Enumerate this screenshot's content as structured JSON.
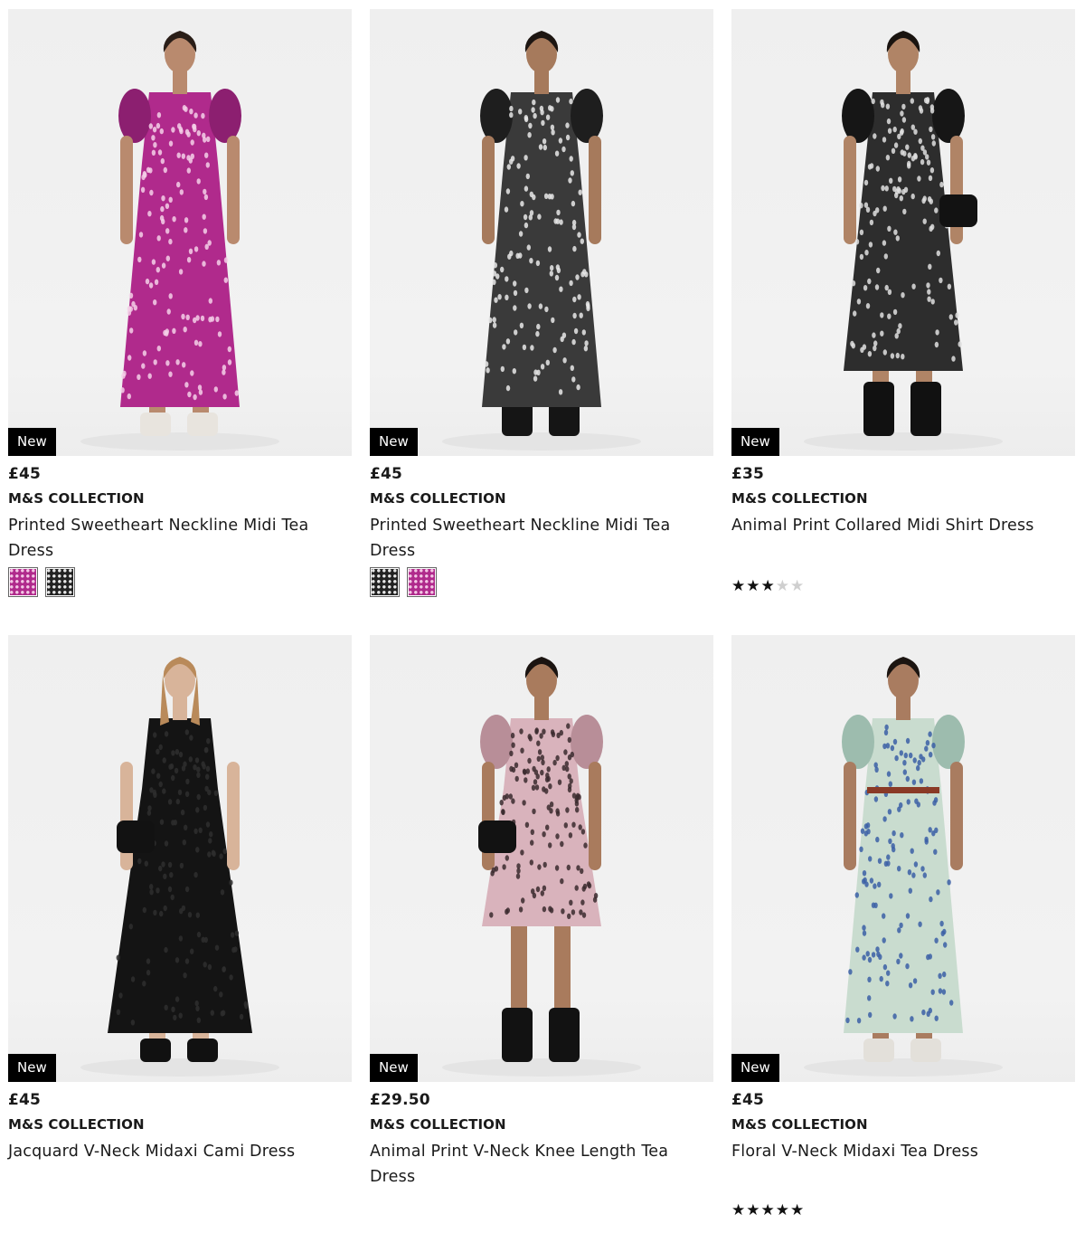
{
  "products": [
    {
      "badge": "New",
      "price": "£45",
      "brand": "M&S COLLECTION",
      "title": "Printed Sweetheart Neckline Midi Tea Dress",
      "image": "model-magenta-spot-dress",
      "colors": {
        "dress": "#b02a8c",
        "dress_dark": "#8c1f70",
        "pattern": "#f5d0e8",
        "shoes": "#e8e4de",
        "skin": "#b98a6e",
        "hair": "#2a1e18"
      },
      "swatches": [
        {
          "name": "magenta-print",
          "base": "#b02a8c",
          "dot": "#f3c6e4"
        },
        {
          "name": "black-white-print",
          "base": "#222222",
          "dot": "#e6e6e6"
        }
      ]
    },
    {
      "badge": "New",
      "price": "£45",
      "brand": "M&S COLLECTION",
      "title": "Printed Sweetheart Neckline Midi Tea Dress",
      "image": "model-monochrome-floral-dress",
      "colors": {
        "dress": "#3a3a3a",
        "dress_dark": "#1e1e1e",
        "pattern": "#e9e9e9",
        "shoes": "#151515",
        "skin": "#a67a5c",
        "hair": "#1d1612"
      },
      "swatches": [
        {
          "name": "black-white-print",
          "base": "#222222",
          "dot": "#e6e6e6"
        },
        {
          "name": "magenta-print",
          "base": "#b02a8c",
          "dot": "#f3c6e4"
        }
      ]
    },
    {
      "price": "£35",
      "badge": "New",
      "brand": "M&S COLLECTION",
      "title": "Animal Print Collared Midi Shirt Dress",
      "image": "model-animal-print-shirt-dress",
      "colors": {
        "dress": "#2d2d2d",
        "dress_dark": "#161616",
        "pattern": "#e0e0e0",
        "shoes": "#111111",
        "skin": "#b08466",
        "hair": "#1a1410"
      },
      "rating": 3
    },
    {
      "badge": "New",
      "price": "£45",
      "brand": "M&S COLLECTION",
      "title": "Jacquard V-Neck Midaxi Cami Dress",
      "image": "model-black-cami-dress",
      "colors": {
        "dress": "#141414",
        "dress_dark": "#050505",
        "pattern": "#2e2e2e",
        "shoes": "#111111",
        "skin": "#d8b49a",
        "hair": "#b98a5a"
      }
    },
    {
      "badge": "New",
      "price": "£29.50",
      "brand": "M&S COLLECTION",
      "title": "Animal Print V-Neck Knee Length Tea Dress",
      "image": "model-pink-animal-print-dress",
      "colors": {
        "dress": "#d9b3bc",
        "dress_dark": "#b88e98",
        "pattern": "#3a2a2e",
        "shoes": "#121212",
        "skin": "#a97b5d",
        "hair": "#1b1411"
      }
    },
    {
      "badge": "New",
      "price": "£45",
      "brand": "M&S COLLECTION",
      "title": "Floral V-Neck Midaxi Tea Dress",
      "image": "model-blue-floral-dress",
      "colors": {
        "dress": "#c9dccf",
        "dress_dark": "#9dbcae",
        "pattern": "#3b5fa6",
        "shoes": "#e3e0da",
        "skin": "#a97c60",
        "hair": "#1c1511"
      },
      "rating": 5
    }
  ]
}
